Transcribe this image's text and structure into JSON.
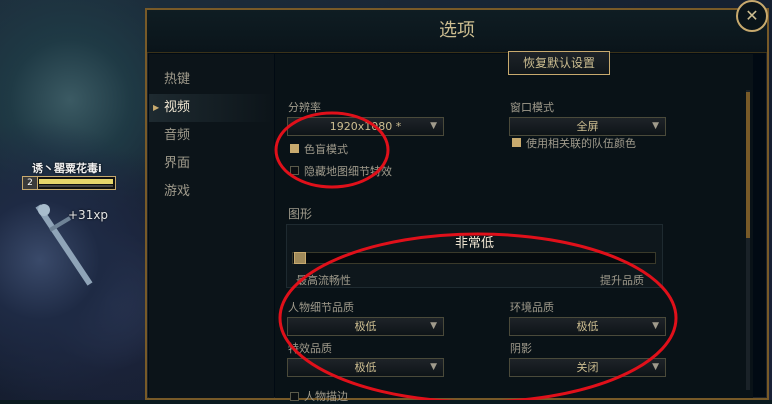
{
  "game": {
    "champion_name": "诱丶罂粟花毒i",
    "level": "2",
    "xp_gain": "+31xp"
  },
  "window": {
    "title": "选项",
    "close_glyph": "✕"
  },
  "sidebar": {
    "items": [
      {
        "label": "热键"
      },
      {
        "label": "视频"
      },
      {
        "label": "音频"
      },
      {
        "label": "界面"
      },
      {
        "label": "游戏"
      }
    ],
    "active_index": 1
  },
  "toolbar": {
    "reset_label": "恢复默认设置"
  },
  "resolution": {
    "label": "分辨率",
    "value": "1920x1080 *"
  },
  "window_mode": {
    "label": "窗口模式",
    "value": "全屏"
  },
  "checkboxes": {
    "colorblind": {
      "label": "色盲模式",
      "checked": true
    },
    "team_colors": {
      "label": "使用相关联的队伍颜色",
      "checked": true
    },
    "hide_eye_candy": {
      "label": "隐藏地图细节特效",
      "checked": false
    },
    "character_inking": {
      "label": "人物描边",
      "checked": false
    }
  },
  "graphics": {
    "section_label": "图形",
    "level_text": "非常低",
    "slider_min_label": "最高流畅性",
    "slider_max_label": "提升品质",
    "slider_value": 0
  },
  "quality": {
    "character": {
      "label": "人物细节品质",
      "value": "极低"
    },
    "environment": {
      "label": "环境品质",
      "value": "极低"
    },
    "effects": {
      "label": "特效品质",
      "value": "极低"
    },
    "shadows": {
      "label": "阴影",
      "value": "关闭"
    }
  },
  "colors": {
    "gold": "#c8aa6e",
    "annotation_red": "#e0101a"
  }
}
